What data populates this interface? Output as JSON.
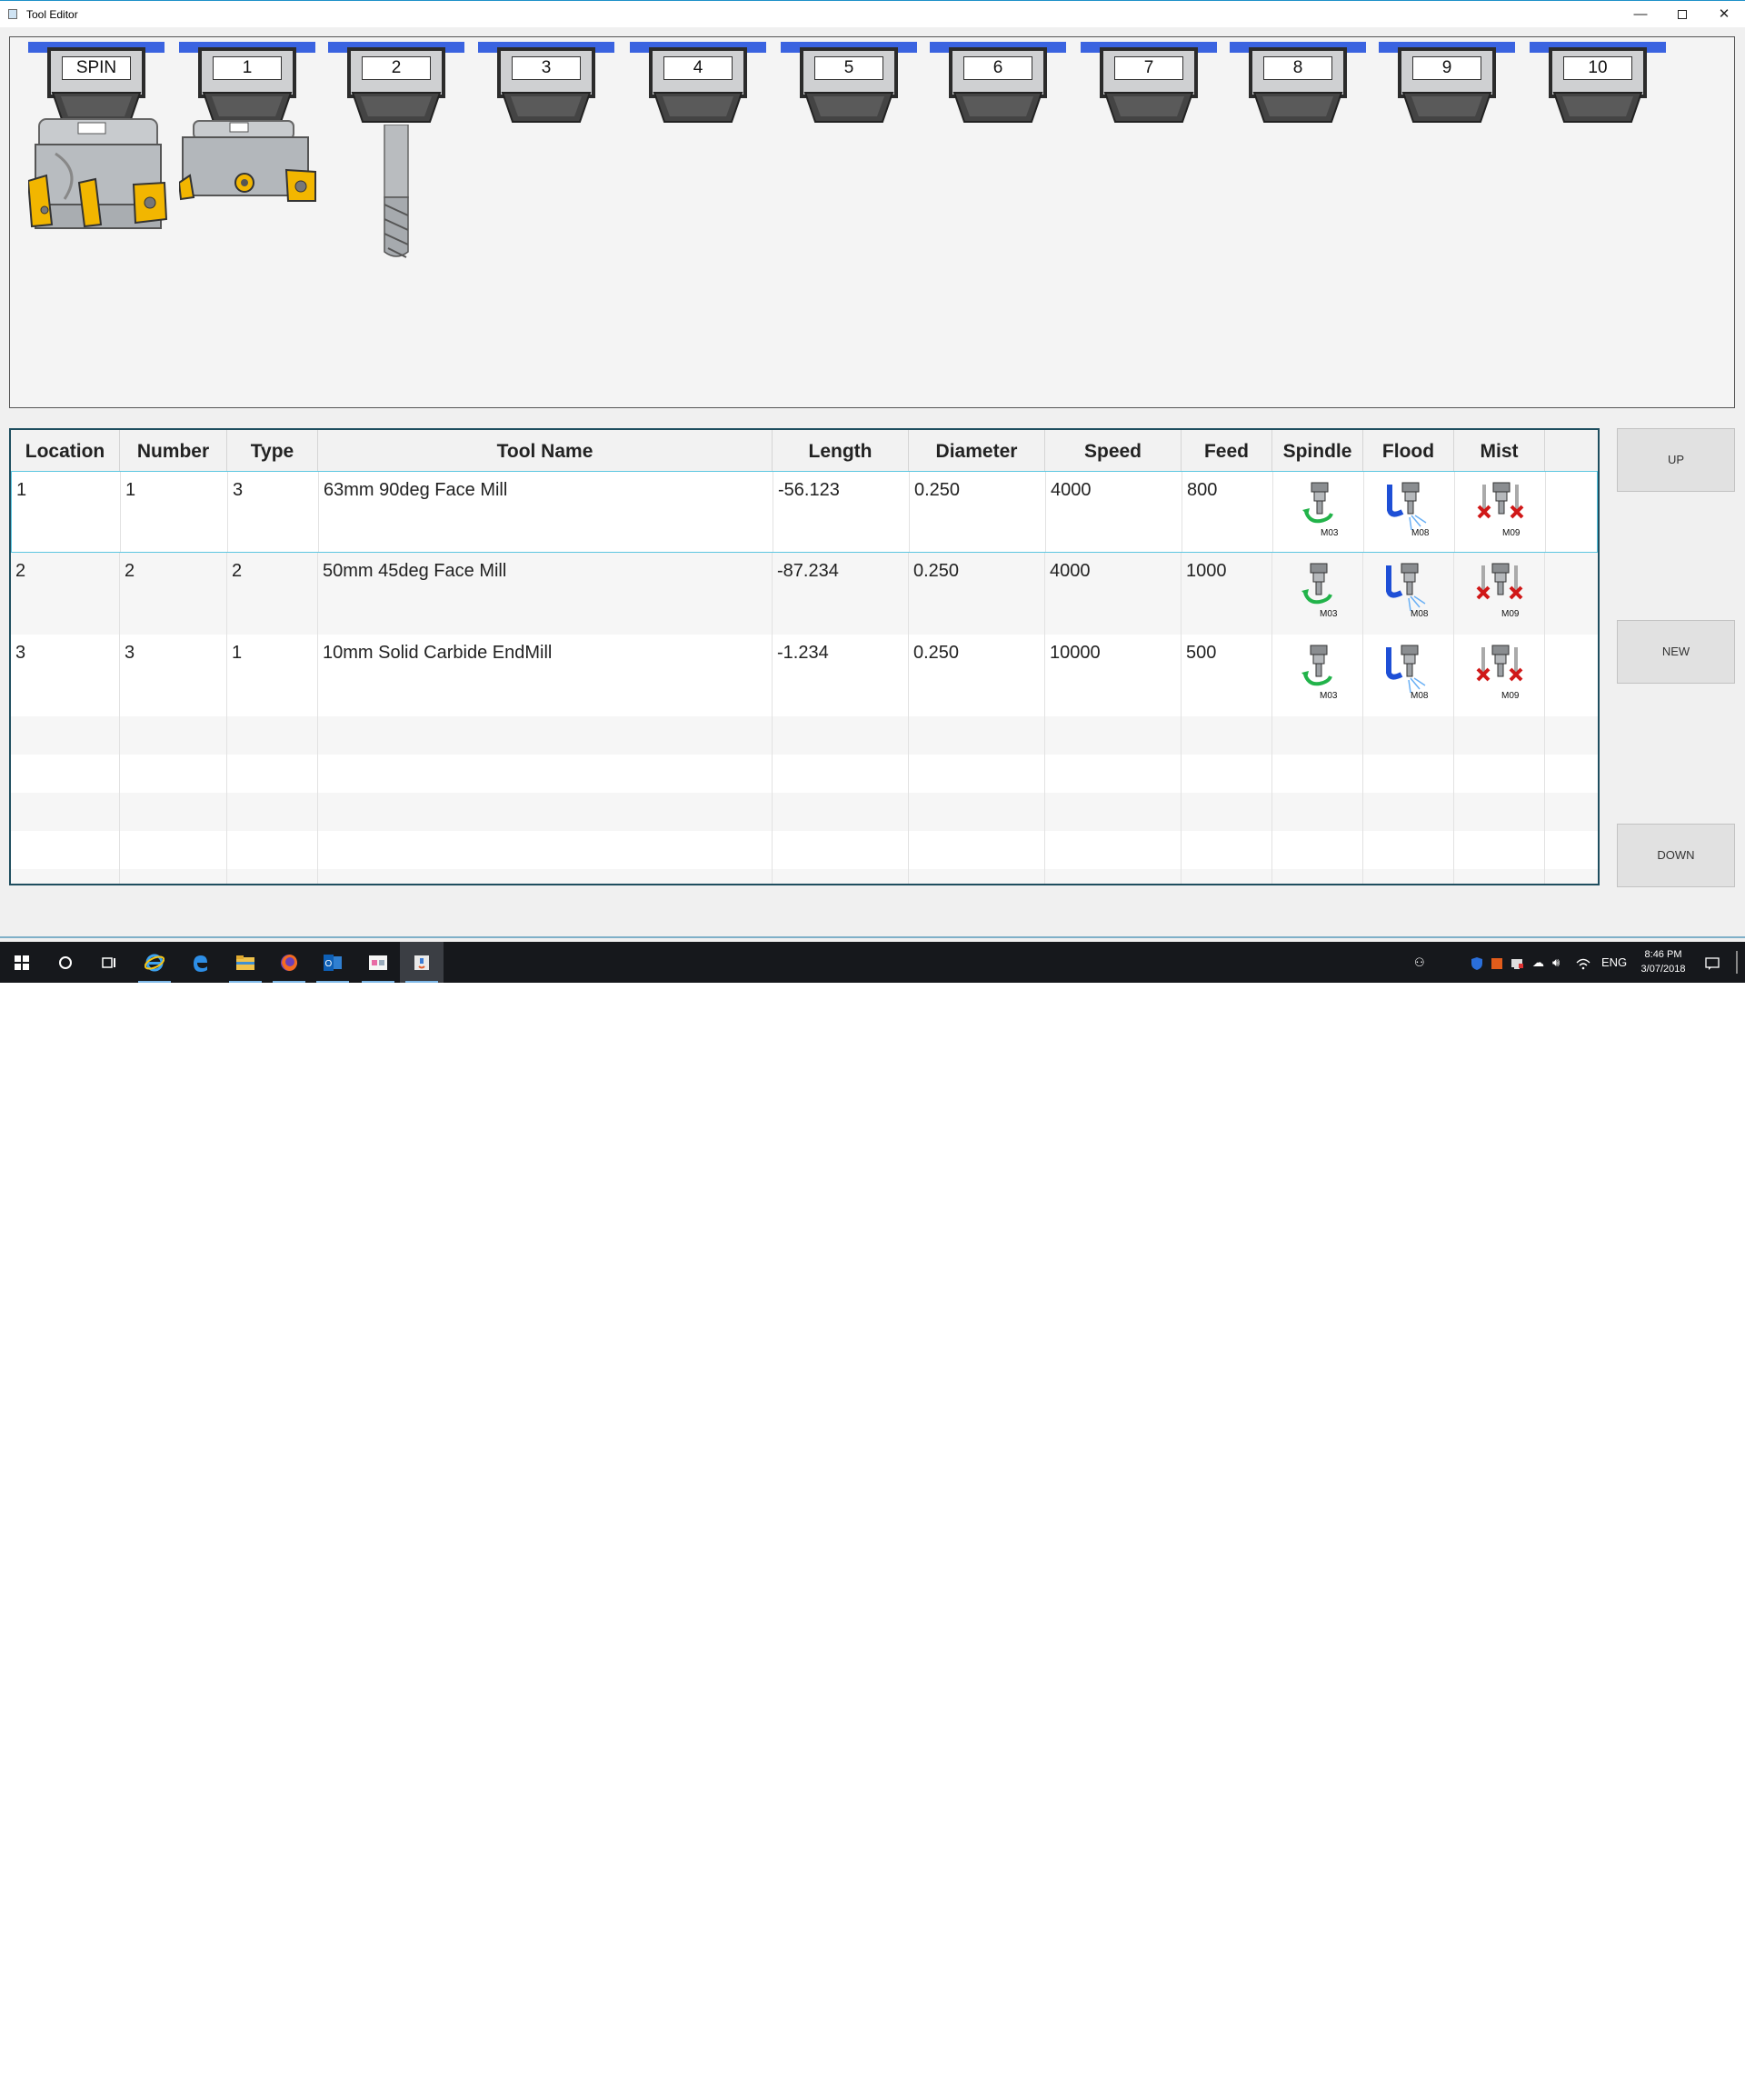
{
  "window": {
    "title": "Tool Editor",
    "controls": {
      "minimize": "—",
      "close": "✕"
    }
  },
  "carousel": {
    "pockets": [
      "SPIN",
      "1",
      "2",
      "3",
      "4",
      "5",
      "6",
      "7",
      "8",
      "9",
      "10"
    ],
    "bar_color": "#3a63e0"
  },
  "table": {
    "columns": [
      "Location",
      "Number",
      "Type",
      "Tool Name",
      "Length",
      "Diameter",
      "Speed",
      "Feed",
      "Spindle",
      "Flood",
      "Mist"
    ],
    "rows": [
      {
        "location": "1",
        "number": "1",
        "type": "3",
        "name": "63mm 90deg Face Mill",
        "length": "-56.123",
        "diameter": "0.250",
        "speed": "4000",
        "feed": "800",
        "spindle": "M03",
        "flood": "M08",
        "mist": "M09"
      },
      {
        "location": "2",
        "number": "2",
        "type": "2",
        "name": "50mm 45deg Face Mill",
        "length": "-87.234",
        "diameter": "0.250",
        "speed": "4000",
        "feed": "1000",
        "spindle": "M03",
        "flood": "M08",
        "mist": "M09"
      },
      {
        "location": "3",
        "number": "3",
        "type": "1",
        "name": "10mm Solid Carbide EndMill",
        "length": "-1.234",
        "diameter": "0.250",
        "speed": "10000",
        "feed": "500",
        "spindle": "M03",
        "flood": "M08",
        "mist": "M09"
      }
    ]
  },
  "buttons": {
    "up": "UP",
    "new": "NEW",
    "down": "DOWN"
  },
  "taskbar": {
    "tray": {
      "lang": "ENG"
    },
    "clock": {
      "time": "8:46 PM",
      "date": "3/07/2018"
    }
  }
}
